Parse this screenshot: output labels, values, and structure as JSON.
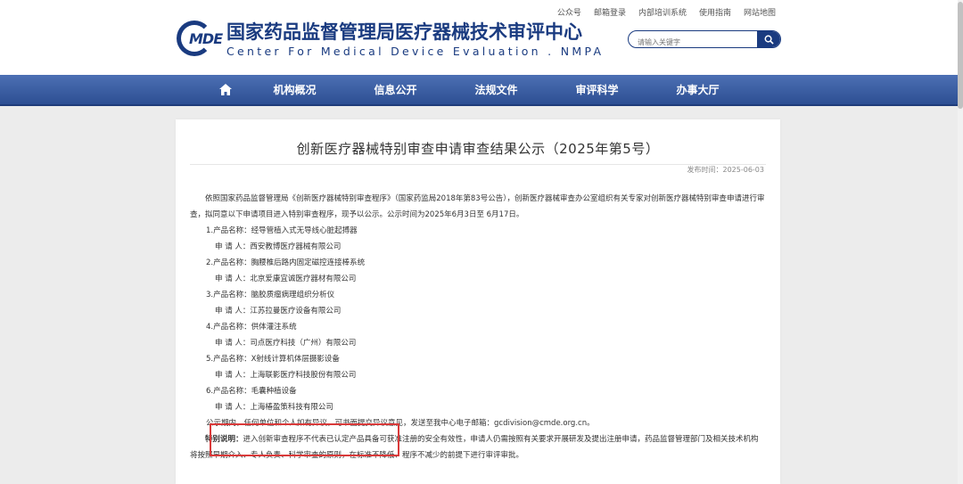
{
  "top_links": [
    "公众号",
    "邮箱登录",
    "内部培训系统",
    "使用指南",
    "网站地图"
  ],
  "logo": {
    "abbr": "MDE",
    "cn": "国家药品监督管理局医疗器械技术审评中心",
    "en": "Center For Medical Device Evaluation . NMPA"
  },
  "search": {
    "placeholder": "请输入关键字",
    "icon": "search-icon"
  },
  "nav": {
    "home_icon": "home-icon",
    "items": [
      "机构概况",
      "信息公开",
      "法规文件",
      "审评科学",
      "办事大厅"
    ]
  },
  "article": {
    "title": "创新医疗器械特别审查申请审查结果公示（2025年第5号）",
    "date": "发布时间：2025-06-03",
    "intro": "依照国家药品监督管理局《创新医疗器械特别审查程序》（国家药监局2018年第83号公告），创新医疗器械审查办公室组织有关专家对创新医疗器械特别审查申请进行审查，拟同意以下申请项目进入特别审查程序，现予以公示。公示时间为2025年6月3日至 6月17日。",
    "items": [
      {
        "product": "1.产品名称：经导管植入式无导线心脏起搏器",
        "applicant": "申 请 人：西安教博医疗器械有限公司"
      },
      {
        "product": "2.产品名称：胸腰椎后路内固定磁控连接棒系统",
        "applicant": "申 请 人：北京爱康宜诚医疗器材有限公司"
      },
      {
        "product": "3.产品名称：脑胶质瘤病理组织分析仪",
        "applicant": "申 请 人：江苏拉曼医疗设备有限公司"
      },
      {
        "product": "4.产品名称：供体灌注系统",
        "applicant": "申 请 人：司点医疗科技（广州）有限公司"
      },
      {
        "product": "5.产品名称：X射线计算机体层摄影设备",
        "applicant": "申 请 人：上海联影医疗科技股份有限公司"
      },
      {
        "product": "6.产品名称：毛囊种植设备",
        "applicant": "申 请 人：上海椿盈策科技有限公司"
      }
    ],
    "notice": "公示期内，任何单位和个人如有异议，可书面提交异议意见，发送至我中心电子邮箱：gcdivision@cmde.org.cn。",
    "special_label": "特别说明：",
    "special_text": "进入创新审查程序不代表已认定产品具备可获准注册的安全有效性，申请人仍需按照有关要求开展研发及提出注册申请，药品监督管理部门及相关技术机构将按照早期介入、专人负责、科学审查的原则，在标准不降低、程序不减少的前提下进行审评审批。"
  },
  "colors": {
    "brand": "#1a3b80",
    "nav": "#3d5fa3",
    "highlight": "#d93a3a"
  }
}
